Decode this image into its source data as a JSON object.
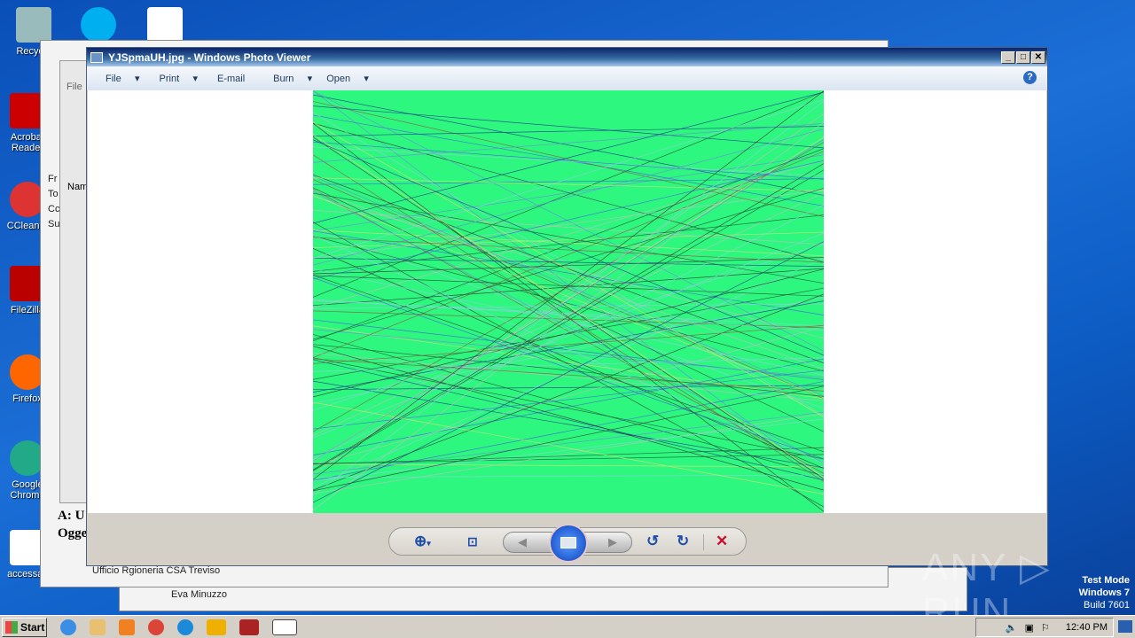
{
  "desktop": {
    "icons": [
      "Recycle",
      "Acrobat Reader",
      "CCleaner",
      "FileZilla",
      "Firefox",
      "Google Chrome",
      "accessac"
    ],
    "watermark": "ANY RUN",
    "test_mode": [
      "Test Mode",
      "Windows 7",
      "Build 7601"
    ]
  },
  "bg_window": {
    "file_label": "File",
    "fields": [
      "Fr",
      "To",
      "Cc",
      "Su"
    ],
    "list_header": "Nam",
    "mail_to": "A: U",
    "mail_subject": "Ogge",
    "contact1": "Ufficio Rgioneria CSA Treviso",
    "contact2": "Eva Minuzzo"
  },
  "viewer": {
    "title": "YJSpmaUH.jpg - Windows Photo Viewer",
    "menu": [
      "File",
      "Print",
      "E-mail",
      "Burn",
      "Open"
    ],
    "help": "?",
    "image_color": "#2ef77f",
    "toolbar": [
      "zoom-icon",
      "fit-icon",
      "previous-icon",
      "slideshow-icon",
      "next-icon",
      "rotate-left-icon",
      "rotate-right-icon",
      "delete-icon"
    ]
  },
  "taskbar": {
    "start": "Start",
    "clock": "12:40 PM"
  }
}
